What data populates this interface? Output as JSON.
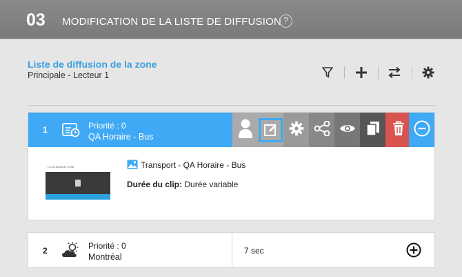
{
  "header": {
    "step_number": "03",
    "title": "MODIFICATION DE LA LISTE DE DIFFUSION",
    "help_glyph": "?"
  },
  "zone": {
    "title": "Liste de diffusion de la zone",
    "subtitle": "Principale - Lecteur 1"
  },
  "toolbar": {
    "icons": [
      "filter-icon",
      "plus-icon",
      "swap-icon",
      "gear-icon"
    ]
  },
  "items": [
    {
      "index": "1",
      "priority": "Priorité : 0",
      "name": "QA Horaire - Bus",
      "icon": "schedule-icon",
      "expanded": true,
      "actions": [
        {
          "icon": "user-icon",
          "color": "#aaaaaa"
        },
        {
          "icon": "edit-icon",
          "color": "#aaaaaa",
          "selected": true
        },
        {
          "icon": "gear-icon",
          "color": "#9a9a9a"
        },
        {
          "icon": "share-icon",
          "color": "#888888"
        },
        {
          "icon": "eye-icon",
          "color": "#777777"
        },
        {
          "icon": "copy-icon",
          "color": "#555555"
        },
        {
          "icon": "trash-icon",
          "color": "#d9534f"
        },
        {
          "icon": "minus-circle-icon",
          "color": "#3fa9f5"
        }
      ],
      "detail": {
        "clip_name": "Transport - QA Horaire - Bus",
        "duration_label": "Durée du clip:",
        "duration_value": "Durée variable",
        "thumb_brand": "C.O.E.DIGNITY.COM"
      }
    },
    {
      "index": "2",
      "priority": "Priorité : 0",
      "name": "Montréal",
      "icon": "weather-icon",
      "duration": "7 sec",
      "action_icon": "plus-circle-icon"
    }
  ],
  "colors": {
    "accent": "#3fa9f5",
    "header_bg": "#808080",
    "delete": "#d9534f"
  }
}
